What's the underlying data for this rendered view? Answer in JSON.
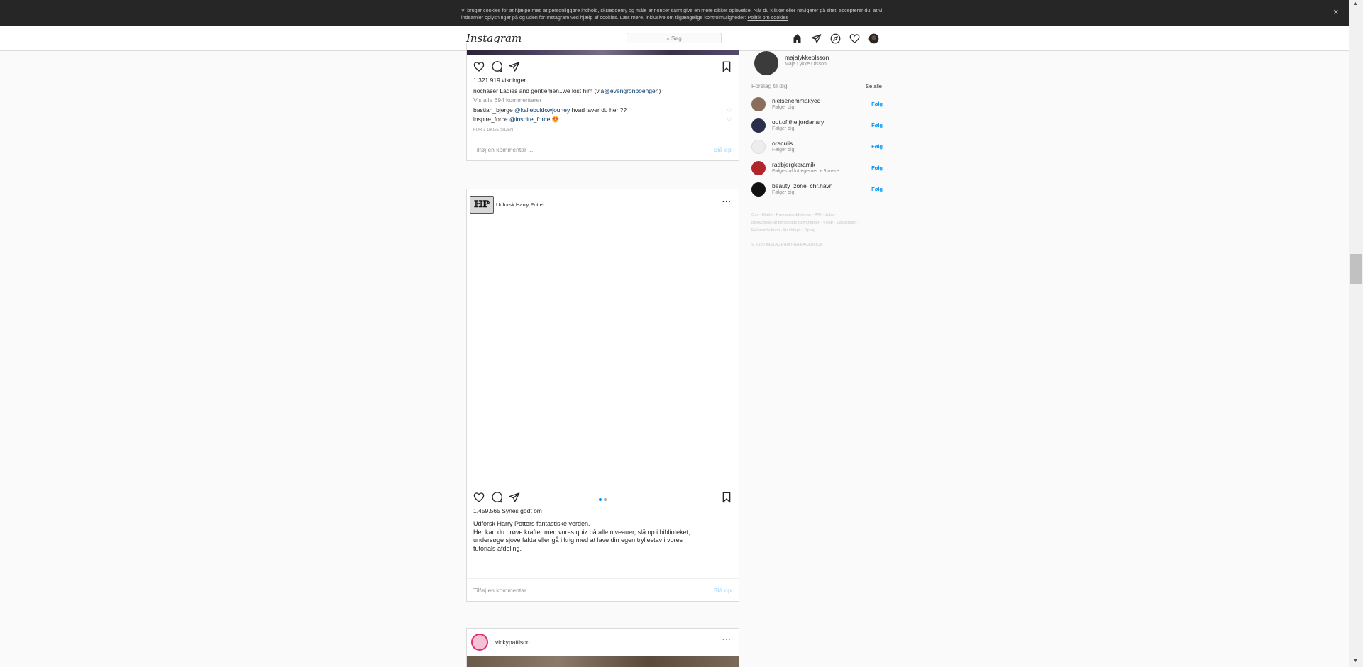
{
  "cookie": {
    "text": "Vi bruger cookies for at hjælpe med at personliggøre indhold, skræddersy og måle annoncer samt give en mere sikker oplevelse. Når du klikker eller navigerer på sitet, accepterer du, at vi indsamler oplysninger på og uden for Instagram ved hjælp af cookies. Læs mere, inklusive om tilgængelige kontrolmuligheder:",
    "link": "Politik om cookies",
    "close": "×"
  },
  "nav": {
    "logo": "Instagram",
    "search_placeholder": "Søg"
  },
  "post1": {
    "views": "1.321.919 visninger",
    "caption_user": "nochaser",
    "caption_text": "Ladies and gentlemen..we lost him (via",
    "caption_mention": "@evengronboengen",
    "caption_end": ")",
    "view_all": "Vis alle 694 kommentarer",
    "c1_user": "bastian_bjerge",
    "c1_mention": "@kallebuldowjouney",
    "c1_text": "hvad laver du her ??",
    "c2_user": "inspire_force",
    "c2_mention": "@inspire_force",
    "c2_emoji": "😍",
    "time": "FOR 2 DAGE SIDEN",
    "comment_placeholder": "Tilføj en kommentar ...",
    "post_btn": "Slå op"
  },
  "post2": {
    "username": "Udforsk Harry Potter",
    "more": "···",
    "likes": "1.459.565 Synes godt om",
    "caption_l1": "Udforsk Harry Potters fantastiske verden.",
    "caption_l2": "Her kan du prøve krafter med vores quiz på alle niveauer, slå op i biblioteket,",
    "caption_l3": "undersøge sjove fakta eller gå i krig med at lave din egen tryllestav i vores",
    "caption_l4": "tutorials afdeling.",
    "comment_placeholder": "Tilføj en kommentar ...",
    "post_btn": "Slå op"
  },
  "post3": {
    "username": "vickypattison",
    "more": "···"
  },
  "sidebar": {
    "user_handle": "majalykkeolsson",
    "user_name": "Maja Lykke Olsson",
    "suggestions_title": "Forslag til dig",
    "see_all": "Se alle",
    "suggestions": [
      {
        "name": "nielsenemmakyed",
        "sub": "Følger dig",
        "follow": "Følg",
        "color": "#8a6d5a"
      },
      {
        "name": "out.of.the.jordanary",
        "sub": "Følger dig",
        "follow": "Følg",
        "color": "#2b2f4a"
      },
      {
        "name": "oraculis",
        "sub": "Følger dig",
        "follow": "Følg",
        "color": "#e8e8e8"
      },
      {
        "name": "radbjergkeramik",
        "sub": "Følges af lottegerner + 3 mere",
        "follow": "Følg",
        "color": "#b0262a"
      },
      {
        "name": "beauty_zone_chr.havn",
        "sub": "Følger dig",
        "follow": "Følg",
        "color": "#111111"
      }
    ],
    "footer_l1": "Om · Hjælp · Pressemeddelelser · API · Jobs ·",
    "footer_l2": "Beskyttelse af personlige oplysninger · Vilkår · Lokaliteter ·",
    "footer_l3": "Relevante konti · Hashtags · Sprog",
    "copyright": "© 2020 INSTAGRAM FRA FACEBOOK"
  }
}
